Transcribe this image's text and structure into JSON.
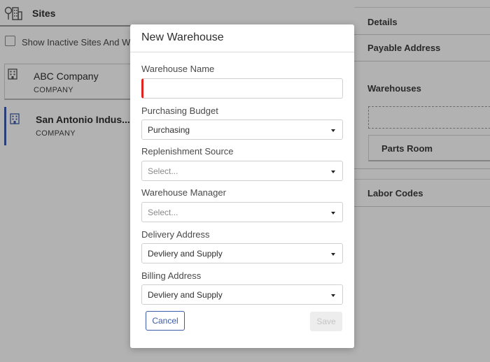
{
  "background": {
    "sites_title": "Sites",
    "show_inactive_label": "Show Inactive Sites And W",
    "sites": [
      {
        "name": "ABC Company",
        "type": "COMPANY"
      },
      {
        "name": "San Antonio Indus...",
        "type": "COMPANY"
      }
    ],
    "right_sections": {
      "details": "Details",
      "payable_address": "Payable Address",
      "warehouses": "Warehouses",
      "parts_room": "Parts Room",
      "labor_codes": "Labor Codes"
    }
  },
  "modal": {
    "title": "New Warehouse",
    "fields": {
      "warehouse_name": {
        "label": "Warehouse Name",
        "value": ""
      },
      "purchasing_budget": {
        "label": "Purchasing Budget",
        "value": "Purchasing"
      },
      "replenishment_source": {
        "label": "Replenishment Source",
        "value": "Select..."
      },
      "warehouse_manager": {
        "label": "Warehouse Manager",
        "value": "Select..."
      },
      "delivery_address": {
        "label": "Delivery Address",
        "value": "Devliery and Supply"
      },
      "billing_address": {
        "label": "Billing Address",
        "value": "Devliery and Supply"
      }
    },
    "buttons": {
      "cancel": "Cancel",
      "save": "Save"
    }
  },
  "colors": {
    "accent": "#3d5ba9",
    "required": "#e0231f",
    "overlay": "rgba(0,0,0,0.30)"
  }
}
